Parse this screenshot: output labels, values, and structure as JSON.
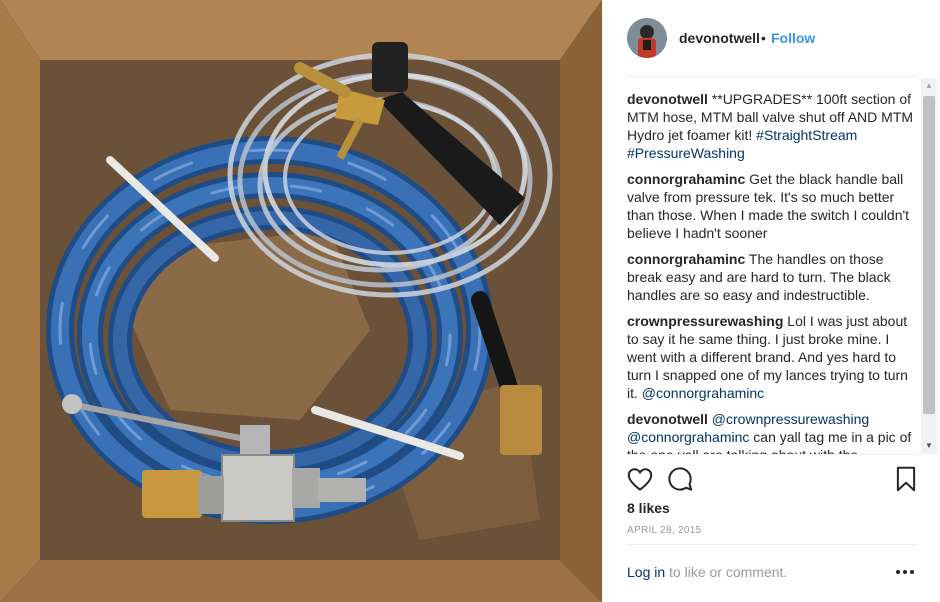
{
  "post": {
    "username": "devonotwell",
    "separator": "•",
    "follow_label": "Follow"
  },
  "comments": [
    {
      "user": "devonotwell",
      "parts": [
        {
          "t": "**UPGRADES** 100ft section of MTM hose, MTM ball valve shut off AND MTM Hydro jet foamer kit! ",
          "tag": false
        },
        {
          "t": "#StraightStream",
          "tag": true
        },
        {
          "t": " ",
          "tag": false
        },
        {
          "t": "#PressureWashing",
          "tag": true
        }
      ]
    },
    {
      "user": "connorgrahaminc",
      "parts": [
        {
          "t": "Get the black handle ball valve from pressure tek. It's so much better than those. When I made the switch I couldn't believe I hadn't sooner",
          "tag": false
        }
      ]
    },
    {
      "user": "connorgrahaminc",
      "parts": [
        {
          "t": "The handles on those break easy and are hard to turn. The black handles are so easy and indestructible.",
          "tag": false
        }
      ]
    },
    {
      "user": "crownpressurewashing",
      "parts": [
        {
          "t": "Lol I was just about to say it he same thing. I just broke mine. I went with a different brand. And yes hard to turn I snapped one of my lances trying to turn it. ",
          "tag": false
        },
        {
          "t": "@connorgrahaminc",
          "tag": true
        }
      ]
    },
    {
      "user": "devonotwell",
      "parts": [
        {
          "t": "@crownpressurewashing",
          "tag": true
        },
        {
          "t": " ",
          "tag": false
        },
        {
          "t": "@connorgrahaminc",
          "tag": true
        },
        {
          "t": " can yall tag me in a pic of the one yall are talking about with the",
          "tag": false
        }
      ]
    }
  ],
  "engagement": {
    "likes": "8 likes",
    "date": "APRIL 28, 2015"
  },
  "footer": {
    "login_link": "Log in",
    "login_rest": " to like or comment."
  },
  "icons": {
    "like": "heart-icon",
    "comment": "comment-bubble-icon",
    "save": "bookmark-icon",
    "more": "more-options-icon"
  },
  "colors": {
    "link_blue": "#3897f0",
    "tag_blue": "#003569",
    "text": "#262626",
    "muted": "#999999",
    "hose_blue": "#2f5f9e"
  }
}
